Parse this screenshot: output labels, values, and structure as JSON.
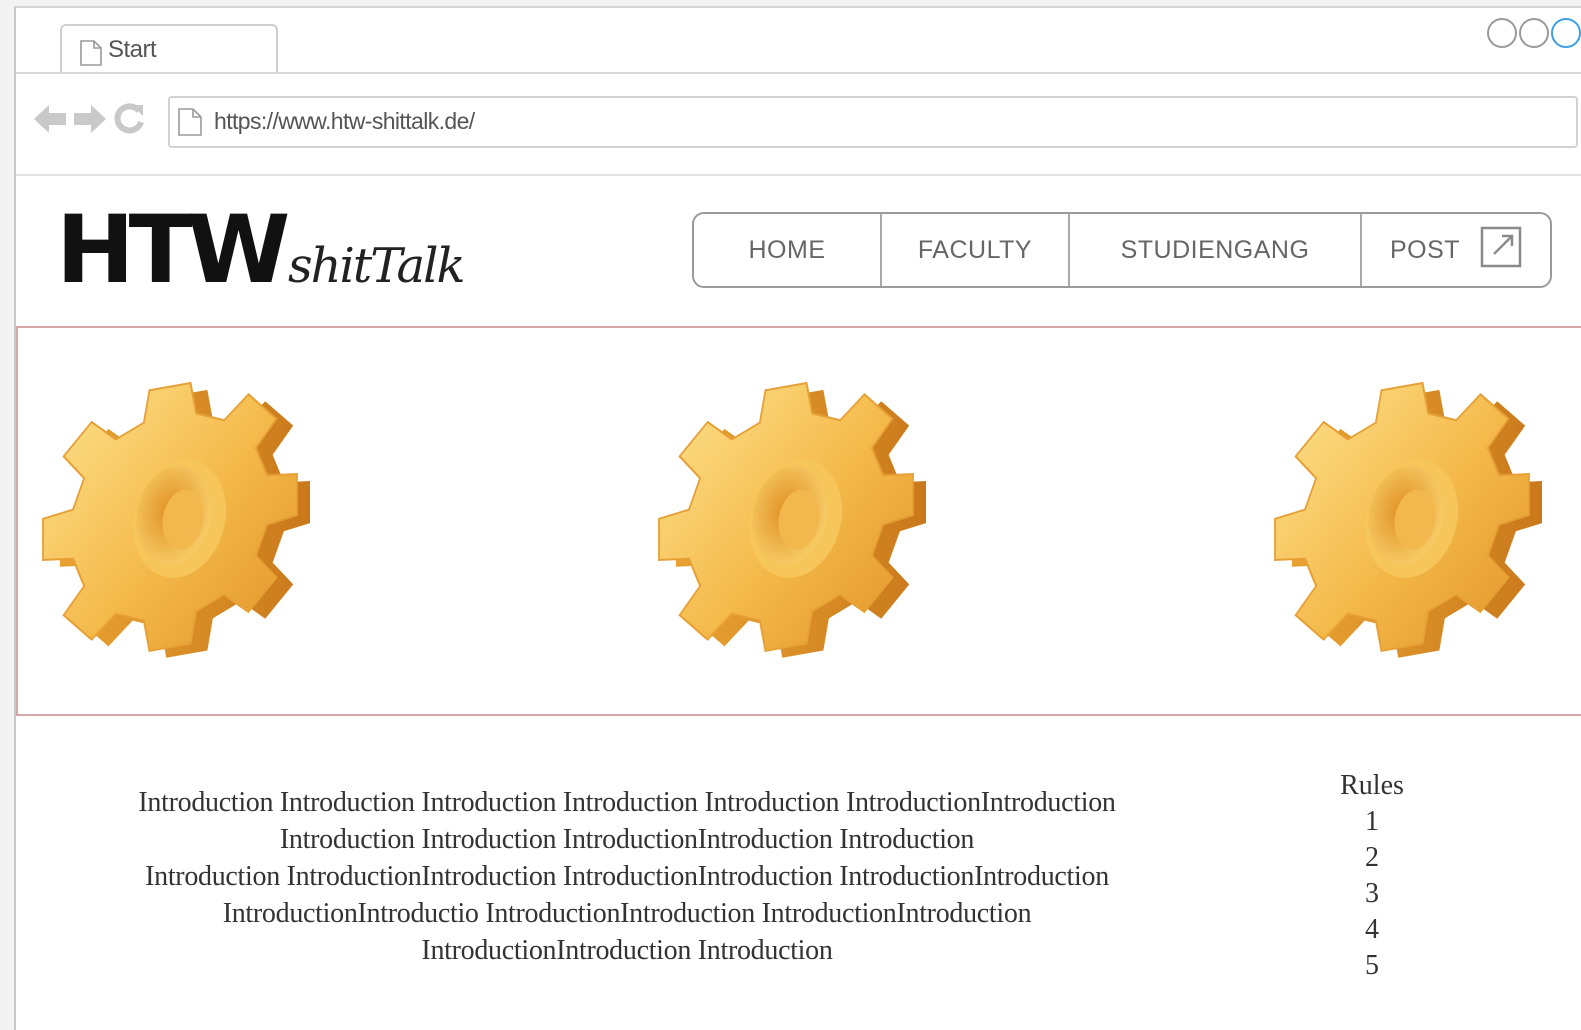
{
  "browser": {
    "tab_title": "Start",
    "url": "https://www.htw-shittalk.de/"
  },
  "site": {
    "logo_main": "HTW",
    "logo_sub": "shitTalk"
  },
  "nav": {
    "home": "HOME",
    "faculty": "FACULTY",
    "studiengang": "STUDIENGANG",
    "post": "POST"
  },
  "content": {
    "intro_lines": [
      "Introduction Introduction Introduction Introduction Introduction IntroductionIntroduction",
      "Introduction Introduction IntroductionIntroduction Introduction",
      "Introduction IntroductionIntroduction IntroductionIntroduction IntroductionIntroduction",
      "IntroductionIntroductio IntroductionIntroduction IntroductionIntroduction",
      "IntroductionIntroduction Introduction"
    ],
    "rules_title": "Rules",
    "rules_items": [
      "1",
      "2",
      "3",
      "4",
      "5"
    ]
  },
  "colors": {
    "gear_light": "#fcd873",
    "gear_mid": "#f2b440",
    "gear_dark": "#d88a1c",
    "banner_border": "#d7a6a6"
  }
}
